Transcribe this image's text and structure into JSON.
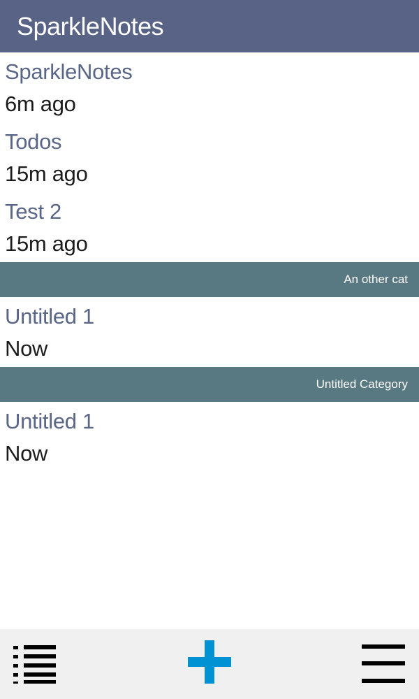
{
  "app": {
    "title": "SparkleNotes"
  },
  "notes_uncategorized": [
    {
      "title": "SparkleNotes",
      "time": "6m ago"
    },
    {
      "title": "Todos",
      "time": "15m ago"
    },
    {
      "title": "Test 2",
      "time": "15m ago"
    }
  ],
  "categories": [
    {
      "name": "An other cat",
      "notes": [
        {
          "title": "Untitled 1",
          "time": "Now"
        }
      ]
    },
    {
      "name": "Untitled Category",
      "notes": [
        {
          "title": "Untitled 1",
          "time": "Now"
        }
      ]
    }
  ],
  "bottombar": {
    "left_icon": "bulleted-list-icon",
    "center_icon": "plus-icon",
    "right_icon": "hamburger-menu-icon"
  },
  "colors": {
    "titlebar": "#596385",
    "category_header": "#587982",
    "note_title": "#5a6688",
    "accent_plus": "#0092d2",
    "bottombar": "#f0f0f0"
  }
}
